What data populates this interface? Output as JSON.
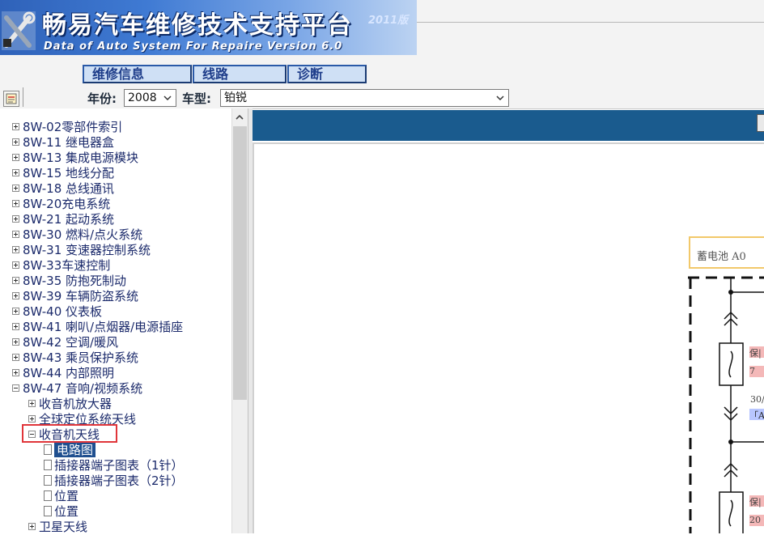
{
  "banner": {
    "title": "畅易汽车维修技术支持平台",
    "year_badge": "2011版",
    "subtitle": "Data of Auto System For Repaire Version 6.0"
  },
  "tabs": [
    {
      "label": "维修信息"
    },
    {
      "label": "线路"
    },
    {
      "label": "诊断"
    }
  ],
  "toolbar": {
    "year_label": "年份:",
    "year_value": "2008",
    "model_label": "车型:",
    "model_value": "铂锐"
  },
  "tree": {
    "items": [
      {
        "label": "8W-02零部件索引"
      },
      {
        "label": "8W-11 继电器盒"
      },
      {
        "label": "8W-13 集成电源模块"
      },
      {
        "label": "8W-15 地线分配"
      },
      {
        "label": "8W-18 总线通讯"
      },
      {
        "label": "8W-20充电系统"
      },
      {
        "label": "8W-21 起动系统"
      },
      {
        "label": "8W-30 燃料/点火系统"
      },
      {
        "label": "8W-31 变速器控制系统"
      },
      {
        "label": "8W-33车速控制"
      },
      {
        "label": "8W-35 防抱死制动"
      },
      {
        "label": "8W-39 车辆防盗系统"
      },
      {
        "label": "8W-40 仪表板"
      },
      {
        "label": "8W-41 喇叭/点烟器/电源插座"
      },
      {
        "label": "8W-42 空调/暖风"
      },
      {
        "label": "8W-43 乘员保护系统"
      },
      {
        "label": "8W-44 内部照明"
      },
      {
        "label": "8W-47 音响/视频系统"
      },
      {
        "label": "收音机放大器"
      },
      {
        "label": "全球定位系统天线"
      },
      {
        "label": "收音机天线"
      },
      {
        "label": "电路图"
      },
      {
        "label": "插接器端子图表（1针）"
      },
      {
        "label": "插接器端子图表（2针）"
      },
      {
        "label": "位置"
      },
      {
        "label": "位置"
      },
      {
        "label": "卫星天线"
      }
    ]
  },
  "diagram": {
    "battery_label": "蓄电池 A0",
    "fuse_tag_1_top": "保|",
    "fuse_tag_1_bottom": "7",
    "amp_text": "30/",
    "amp_tag": "「A",
    "fuse_tag_2_top": "保|",
    "fuse_tag_2_bottom": "20"
  },
  "colors": {
    "banner_blue": "#2f62b9",
    "header_blue": "#1a5b8e",
    "selected_bg": "#1f4f8f",
    "highlight_red": "#e0353a",
    "tree_text": "#1b2a6b"
  }
}
